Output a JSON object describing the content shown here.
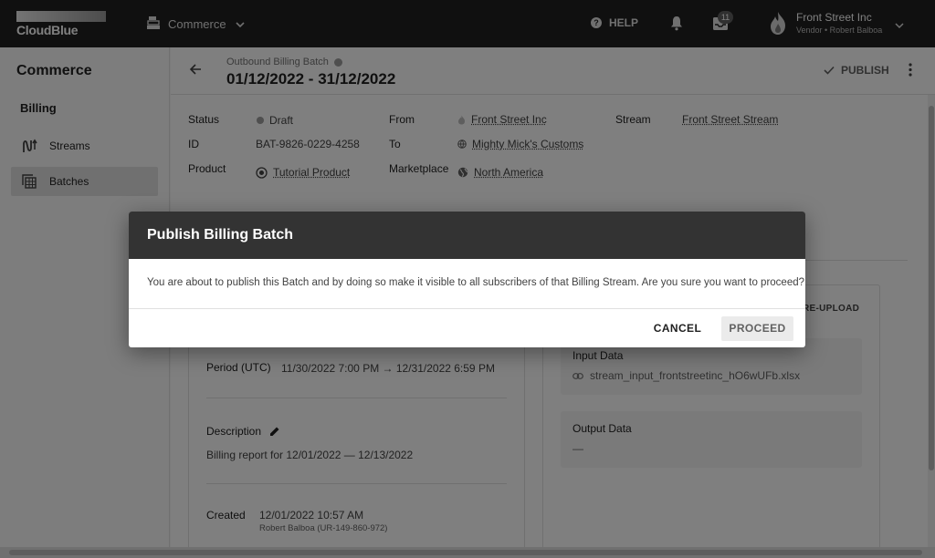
{
  "topbar": {
    "logo_text": "CloudBlue",
    "module_label": "Commerce",
    "help_label": "HELP",
    "notification_count": "11",
    "account_name": "Front Street Inc",
    "account_sub": "Vendor • Robert Balboa"
  },
  "sidebar": {
    "title": "Commerce",
    "section": "Billing",
    "items": [
      {
        "label": "Streams",
        "icon": "streams-icon"
      },
      {
        "label": "Batches",
        "icon": "batches-icon",
        "active": true
      }
    ]
  },
  "page": {
    "breadcrumb": "Outbound Billing Batch",
    "title": "01/12/2022 - 31/12/2022",
    "publish_label": "PUBLISH"
  },
  "details": {
    "status_label": "Status",
    "status_value": "Draft",
    "id_label": "ID",
    "id_value": "BAT-9826-0229-4258",
    "product_label": "Product",
    "product_value": "Tutorial Product",
    "from_label": "From",
    "from_value": "Front Street Inc",
    "to_label": "To",
    "to_value": "Mighty Mick's Customs",
    "marketplace_label": "Marketplace",
    "marketplace_value": "North America",
    "stream_label": "Stream",
    "stream_value": "Front Street Stream"
  },
  "left_card": {
    "period_label": "Period (UTC)",
    "period_value": "11/30/2022 7:00 PM → 12/31/2022 6:59 PM",
    "description_label": "Description",
    "description_value": "Billing report for 12/01/2022 — 12/13/2022",
    "created_label": "Created",
    "created_value": "12/01/2022 10:57 AM",
    "created_by": "Robert Balboa (UR-149-860-972)"
  },
  "right_card": {
    "reupload_label": "RE-UPLOAD",
    "input_label": "Input Data",
    "input_value": "stream_input_frontstreetinc_hO6wUFb.xlsx",
    "output_label": "Output Data",
    "output_value": "—"
  },
  "dialog": {
    "title": "Publish Billing Batch",
    "message": "You are about to publish this Batch and by doing so make it visible to all subscribers of that Billing Stream. Are you sure you want to proceed?",
    "cancel_label": "CANCEL",
    "proceed_label": "PROCEED"
  }
}
